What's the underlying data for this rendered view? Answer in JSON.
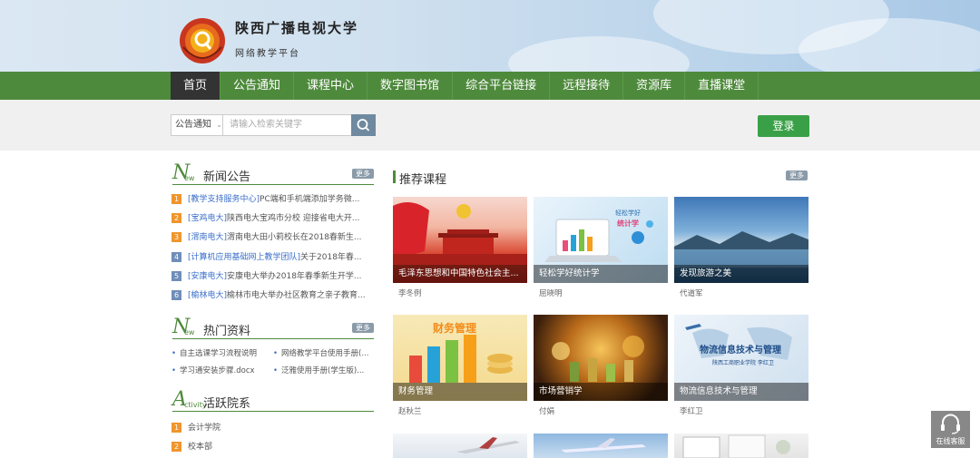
{
  "header": {
    "title": "陕西广播电视大学",
    "subtitle": "网络教学平台"
  },
  "nav": [
    {
      "label": "首页",
      "active": true
    },
    {
      "label": "公告通知"
    },
    {
      "label": "课程中心"
    },
    {
      "label": "数字图书馆"
    },
    {
      "label": "综合平台链接"
    },
    {
      "label": "远程接待"
    },
    {
      "label": "资源库"
    },
    {
      "label": "直播课堂"
    }
  ],
  "search": {
    "category": "公告通知",
    "placeholder": "请输入检索关键字"
  },
  "login_label": "登录",
  "more_label": "更多",
  "news": {
    "title": "新闻公告",
    "badge_big": "N",
    "badge_small": "ew",
    "items": [
      {
        "num": "1",
        "tag": "[教学支持服务中心]",
        "text": "PC端和手机端添加学务微..."
      },
      {
        "num": "2",
        "tag": "[宝鸡电大]",
        "text": "陕西电大宝鸡市分校 迎接省电大开..."
      },
      {
        "num": "3",
        "tag": "[渭南电大]",
        "text": "渭南电大田小莉校长在2018春新生..."
      },
      {
        "num": "4",
        "tag": "[计算机应用基础网上教学团队]",
        "text": "关于2018年春..."
      },
      {
        "num": "5",
        "tag": "[安康电大]",
        "text": "安康电大举办2018年春季新生开学..."
      },
      {
        "num": "6",
        "tag": "[榆林电大]",
        "text": "榆林市电大举办社区教育之亲子教育..."
      }
    ]
  },
  "hot": {
    "title": "热门资料",
    "badge_big": "N",
    "badge_small": "ew",
    "items": [
      {
        "text": "自主选课学习流程说明"
      },
      {
        "text": "网络教学平台使用手册(..."
      },
      {
        "text": "学习通安装步骤.docx"
      },
      {
        "text": "泛雅使用手册(学生版)..."
      }
    ]
  },
  "active": {
    "title": "活跃院系",
    "badge_big": "A",
    "badge_small": "ctivity",
    "items": [
      {
        "num": "1",
        "text": "会计学院"
      },
      {
        "num": "2",
        "text": "校本部"
      }
    ]
  },
  "recommend": {
    "title": "推荐课程",
    "courses": [
      {
        "title": "毛泽东思想和中国特色社会主...",
        "teacher": "李冬例",
        "theme": "red"
      },
      {
        "title": "轻松学好统计学",
        "teacher": "屈晓明",
        "theme": "stats",
        "img_text1": "轻松学好",
        "img_text2": "统计学"
      },
      {
        "title": "发现旅游之美",
        "teacher": "代道军",
        "theme": "lake"
      },
      {
        "title": "财务管理",
        "teacher": "赵秋兰",
        "theme": "finance",
        "img_text1": "财务管理"
      },
      {
        "title": "市场营销学",
        "teacher": "付娟",
        "theme": "market"
      },
      {
        "title": "物流信息技术与管理",
        "teacher": "李红卫",
        "theme": "logistics",
        "img_text1": "物流信息技术与管理",
        "img_text2": "陕西工商职业学院 李红卫"
      }
    ]
  },
  "customer_service_label": "在线客服",
  "colors": {
    "nav_green": "#4e8a3c",
    "login_green": "#3aa047",
    "link_blue": "#3a6ec8",
    "num_orange": "#f0952c",
    "num_blue": "#6f8eb8"
  }
}
